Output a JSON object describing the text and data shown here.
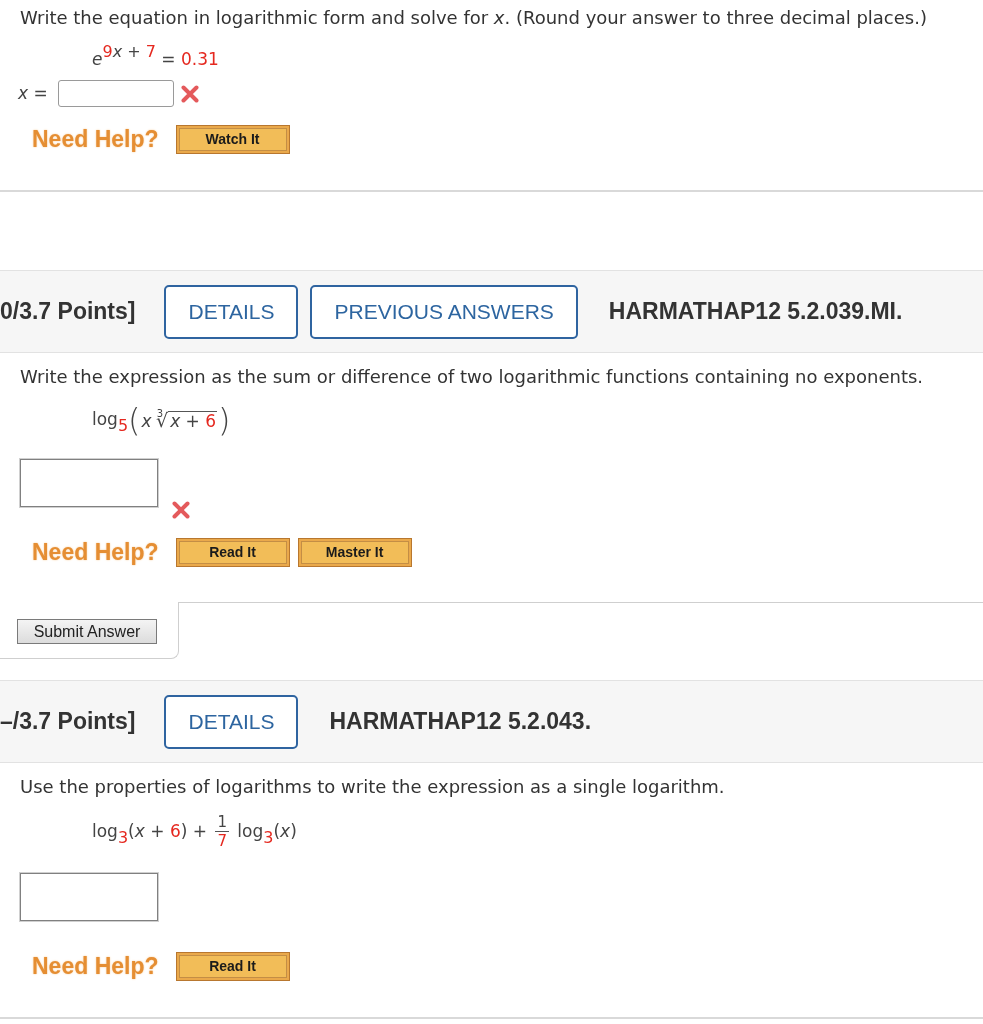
{
  "problems": [
    {
      "question": "Write the equation in logarithmic form and solve for *x*. (Round your answer to three decimal places.)",
      "math": [
        {
          "kind": "var",
          "text": "e"
        },
        {
          "kind": "sup",
          "parts": [
            {
              "kind": "num",
              "text": "9"
            },
            {
              "kind": "var",
              "text": "x"
            },
            {
              "kind": "text",
              "text": " + "
            },
            {
              "kind": "num",
              "text": "7"
            }
          ]
        },
        {
          "kind": "text",
          "text": " = "
        },
        {
          "kind": "num",
          "text": "0.31"
        }
      ],
      "answer": {
        "kind": "inline",
        "label": "*x* =",
        "wrong": true
      },
      "help": {
        "label": "Need Help?",
        "buttons": [
          "Watch It"
        ]
      }
    },
    {
      "header": {
        "points": "0/3.7 Points]",
        "buttons": [
          "DETAILS",
          "PREVIOUS ANSWERS"
        ],
        "code": "HARMATHAP12 5.2.039.MI."
      },
      "question": "Write the expression as the sum or difference of two logarithmic functions containing no exponents.",
      "math": [
        {
          "kind": "text",
          "text": "log"
        },
        {
          "kind": "sub",
          "parts": [
            {
              "kind": "num",
              "text": "5"
            }
          ]
        },
        {
          "kind": "paren",
          "open": "(",
          "close": ")",
          "parts": [
            {
              "kind": "var",
              "text": "x"
            },
            {
              "kind": "root",
              "index": "3",
              "sign": "√",
              "parts": [
                {
                  "kind": "var",
                  "text": "x"
                },
                {
                  "kind": "text",
                  "text": " + "
                },
                {
                  "kind": "num",
                  "text": "6"
                }
              ]
            }
          ]
        }
      ],
      "answer": {
        "kind": "box",
        "wrong": true
      },
      "help": {
        "label": "Need Help?",
        "buttons": [
          "Read It",
          "Master It"
        ]
      },
      "submit": "Submit Answer"
    },
    {
      "header": {
        "points": "–/3.7 Points]",
        "buttons": [
          "DETAILS"
        ],
        "code": "HARMATHAP12 5.2.043."
      },
      "question": "Use the properties of logarithms to write the expression as a single logarithm.",
      "math": [
        {
          "kind": "text",
          "text": "log"
        },
        {
          "kind": "sub",
          "parts": [
            {
              "kind": "num",
              "text": "3"
            }
          ]
        },
        {
          "kind": "text",
          "text": "("
        },
        {
          "kind": "var",
          "text": "x"
        },
        {
          "kind": "text",
          "text": " + "
        },
        {
          "kind": "num",
          "text": "6"
        },
        {
          "kind": "text",
          "text": ") + "
        },
        {
          "kind": "frac",
          "num": [
            {
              "kind": "text",
              "text": "1"
            }
          ],
          "den": [
            {
              "kind": "num",
              "text": "7"
            }
          ]
        },
        {
          "kind": "text",
          "text": " log"
        },
        {
          "kind": "sub",
          "parts": [
            {
              "kind": "num",
              "text": "3"
            }
          ]
        },
        {
          "kind": "text",
          "text": "("
        },
        {
          "kind": "var",
          "text": "x"
        },
        {
          "kind": "text",
          "text": ")"
        }
      ],
      "answer": {
        "kind": "box",
        "wrong": false
      },
      "help": {
        "label": "Need Help?",
        "buttons": [
          "Read It"
        ]
      }
    }
  ]
}
